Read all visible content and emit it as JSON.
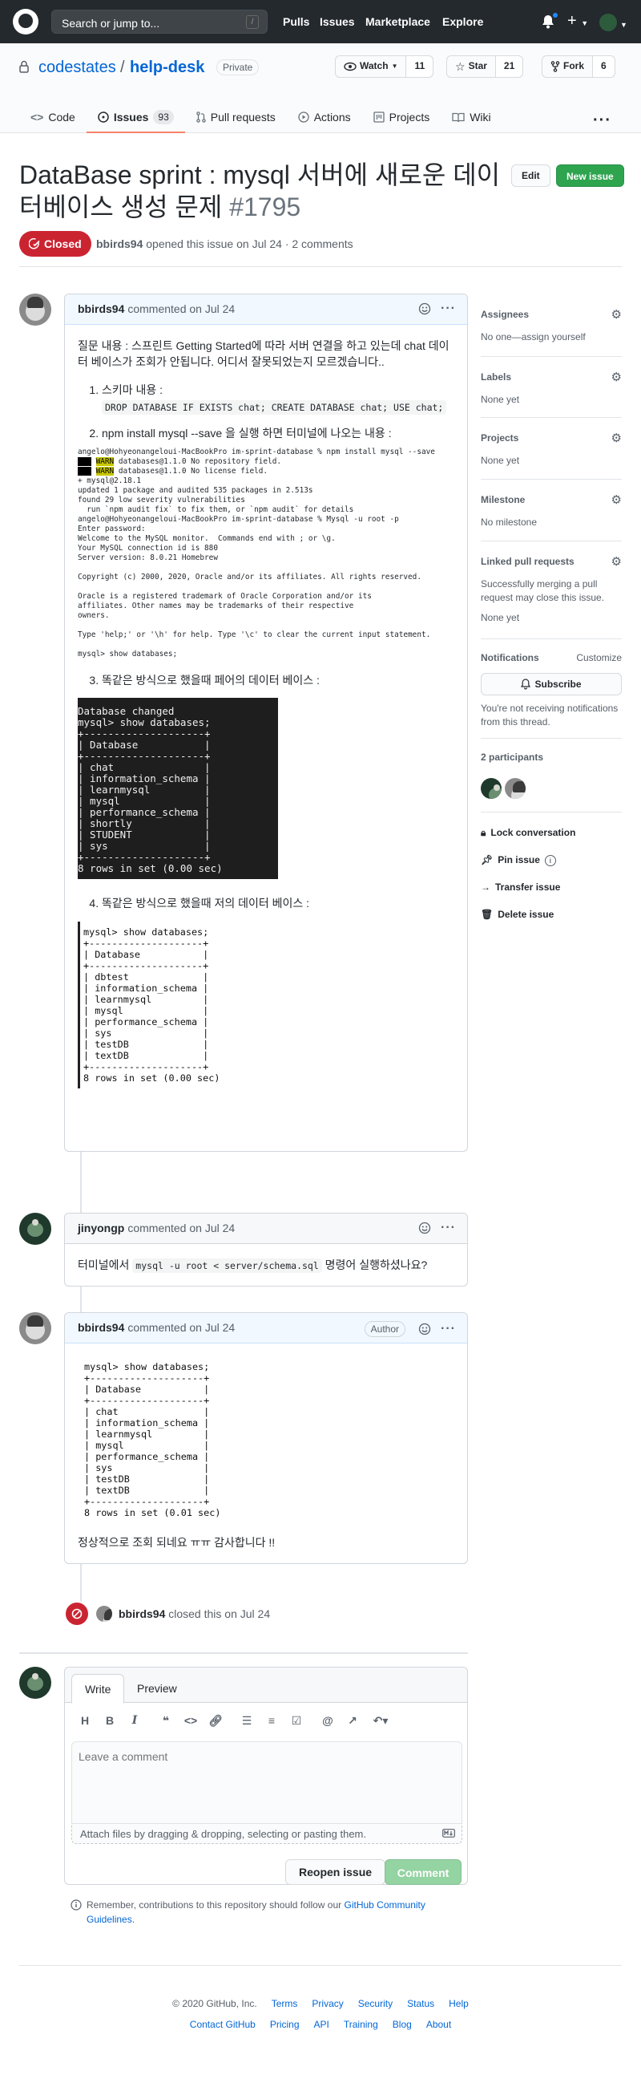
{
  "header": {
    "search_placeholder": "Search or jump to...",
    "search_key": "/",
    "nav": [
      "Pulls",
      "Issues",
      "Marketplace",
      "Explore"
    ],
    "plus": "+"
  },
  "repo": {
    "owner": "codestates",
    "slash": "/",
    "name": "help-desk",
    "visibility": "Private",
    "watch_label": "Watch",
    "watch_count": "11",
    "star_label": "Star",
    "star_count": "21",
    "fork_label": "Fork",
    "fork_count": "6",
    "tabs": [
      {
        "label": "Code",
        "icon": "code-icon"
      },
      {
        "label": "Issues",
        "count": "93",
        "icon": "issue-opened-icon"
      },
      {
        "label": "Pull requests",
        "icon": "git-pull-request-icon"
      },
      {
        "label": "Actions",
        "icon": "play-icon"
      },
      {
        "label": "Projects",
        "icon": "project-icon"
      },
      {
        "label": "Wiki",
        "icon": "book-icon"
      }
    ],
    "more": "···"
  },
  "issue": {
    "title": "DataBase sprint : mysql 서버에 새로운 데이터베이스 생성 문제",
    "number": "#1795",
    "edit_label": "Edit",
    "new_label": "New issue",
    "state": "Closed",
    "meta_author": "bbirds94",
    "meta_text": "opened this issue on Jul 24 · 2 comments"
  },
  "comments": [
    {
      "author": "bbirds94",
      "when": "commented on Jul 24",
      "intro": "질문 내용 : 스프린트 Getting Started에 따라 서버 연결을 하고 있는데 chat 데이터 베이스가 조회가 안됩니다. 어디서 잘못되었는지 모르겠습니다..",
      "item1_label": "스키마 내용 :",
      "item1_code": "DROP DATABASE IF EXISTS chat; CREATE DATABASE chat; USE chat;",
      "item2_label": "npm install mysql --save 을 실행 하면 터미널에 나오는 내용 :",
      "log_line1": "angelo@Hohyeonangeloui-MacBookPro im-sprint-database % npm install mysql --save",
      "log_warn": "WARN",
      "log_warn1": " databases@1.1.0 No repository field.",
      "log_warn2": " databases@1.1.0 No license field.",
      "log_rest": "\n+ mysql@2.18.1\nupdated 1 package and audited 535 packages in 2.513s\nfound 29 low severity vulnerabilities\n  run `npm audit fix` to fix them, or `npm audit` for details\nangelo@Hohyeonangeloui-MacBookPro im-sprint-database % Mysql -u root -p\nEnter password:\nWelcome to the MySQL monitor.  Commands end with ; or \\g.\nYour MySQL connection id is 880\nServer version: 8.0.21 Homebrew\n\nCopyright (c) 2000, 2020, Oracle and/or its affiliates. All rights reserved.\n\nOracle is a registered trademark of Oracle Corporation and/or its\naffiliates. Other names may be trademarks of their respective\nowners.\n\nType 'help;' or '\\h' for help. Type '\\c' to clear the current input statement.\n\nmysql> show databases;",
      "item3_label": "똑같은 방식으로 했을때 페어의 데이터 베이스 :",
      "pair_db": "Database changed\nmysql> show databases;\n+--------------------+\n| Database           |\n+--------------------+\n| chat               |\n| information_schema |\n| learnmysql         |\n| mysql              |\n| performance_schema |\n| shortly            |\n| STUDENT            |\n| sys                |\n+--------------------+\n8 rows in set (0.00 sec)",
      "item4_label": "똑같은 방식으로 했을때 저의 데이터 베이스 :",
      "my_db": "mysql> show databases;\n+--------------------+\n| Database           |\n+--------------------+\n| dbtest             |\n| information_schema |\n| learnmysql         |\n| mysql              |\n| performance_schema |\n| sys                |\n| testDB             |\n| textDB             |\n+--------------------+\n8 rows in set (0.00 sec)"
    },
    {
      "author": "jinyongp",
      "when": "commented on Jul 24",
      "text_before": "터미널에서 ",
      "code": "mysql -u root < server/schema.sql",
      "text_after": " 명령어 실행하셨나요?"
    },
    {
      "author": "bbirds94",
      "when": "commented on Jul 24",
      "badge": "Author",
      "db_output": "mysql> show databases;\n+--------------------+\n| Database           |\n+--------------------+\n| chat               |\n| information_schema |\n| learnmysql         |\n| mysql              |\n| performance_schema |\n| sys                |\n| testDB             |\n| textDB             |\n+--------------------+\n8 rows in set (0.01 sec)",
      "text": "정상적으로 조회 되네요 ㅠㅠ 감사합니다 !!"
    }
  ],
  "closed_event": {
    "author": "bbirds94",
    "text": "closed this on Jul 24"
  },
  "sidebar": {
    "assignees_title": "Assignees",
    "assignees_value": "No one—assign yourself",
    "labels_title": "Labels",
    "labels_value": "None yet",
    "projects_title": "Projects",
    "projects_value": "None yet",
    "milestone_title": "Milestone",
    "milestone_value": "No milestone",
    "linked_title": "Linked pull requests",
    "linked_desc": "Successfully merging a pull request may close this issue.",
    "linked_value": "None yet",
    "notifications_title": "Notifications",
    "customize": "Customize",
    "subscribe": "Subscribe",
    "notif_desc": "You're not receiving notifications from this thread.",
    "participants_title": "2 participants",
    "lock": "Lock conversation",
    "pin": "Pin issue",
    "transfer": "Transfer issue",
    "delete": "Delete issue"
  },
  "new_comment": {
    "tab_write": "Write",
    "tab_preview": "Preview",
    "placeholder": "Leave a comment",
    "attach": "Attach files by dragging & dropping, selecting or pasting them.",
    "reopen": "Reopen issue",
    "submit": "Comment",
    "hint_text": "Remember, contributions to this repository should follow our ",
    "hint_link": "GitHub Community Guidelines",
    "hint_end": "."
  },
  "footer": {
    "copyright": "© 2020 GitHub, Inc.",
    "row1": [
      "Terms",
      "Privacy",
      "Security",
      "Status",
      "Help"
    ],
    "row2": [
      "Contact GitHub",
      "Pricing",
      "API",
      "Training",
      "Blog",
      "About"
    ]
  },
  "colors": {
    "header_bg": "#24292e",
    "closed_red": "#cb2431",
    "link_blue": "#0366d6",
    "green_button": "#2ea44f",
    "tab_underline": "#f9826c"
  }
}
